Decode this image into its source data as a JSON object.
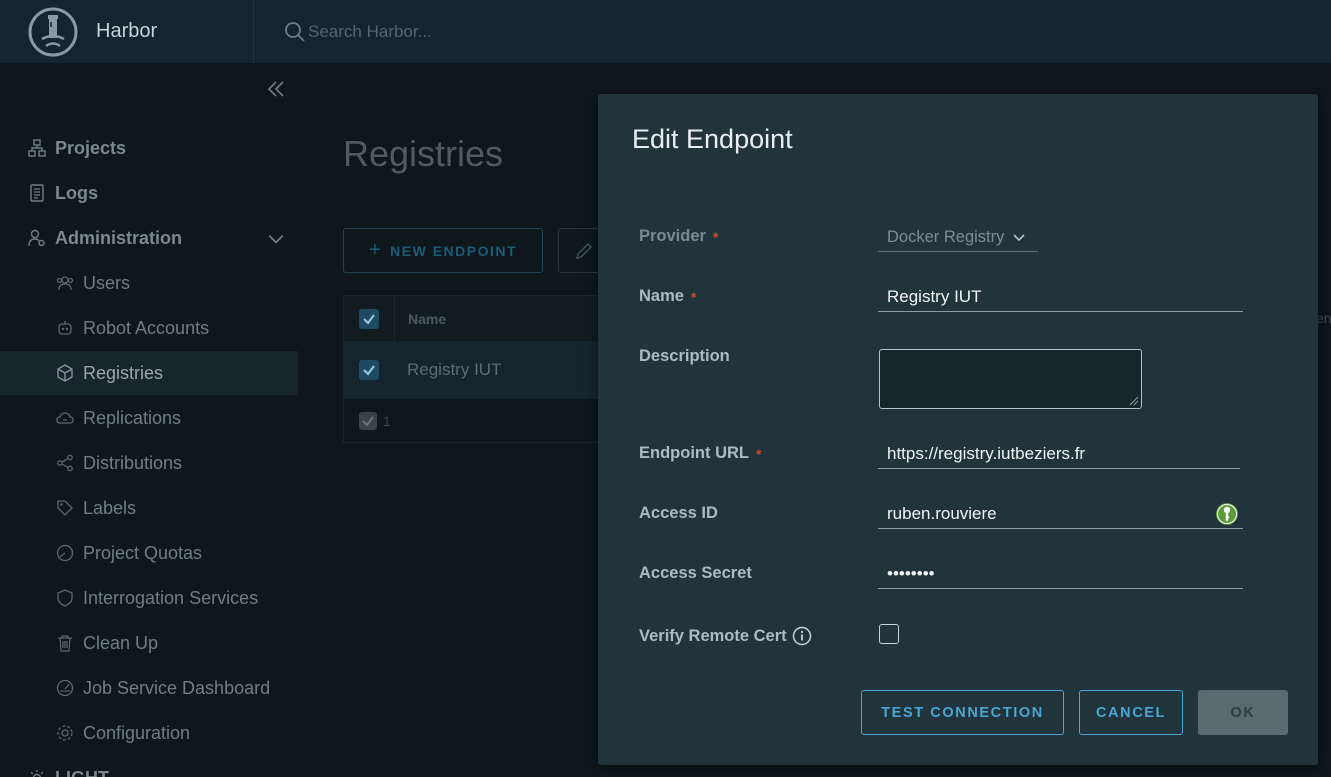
{
  "header": {
    "app_name": "Harbor",
    "search_placeholder": "Search Harbor..."
  },
  "sidebar": {
    "top_items": [
      {
        "label": "Projects",
        "icon": "projects-icon"
      },
      {
        "label": "Logs",
        "icon": "logs-icon"
      },
      {
        "label": "Administration",
        "icon": "administration-icon"
      }
    ],
    "admin_items": [
      {
        "label": "Users",
        "icon": "users-icon"
      },
      {
        "label": "Robot Accounts",
        "icon": "robot-icon"
      },
      {
        "label": "Registries",
        "icon": "registries-icon",
        "active": true
      },
      {
        "label": "Replications",
        "icon": "replications-icon"
      },
      {
        "label": "Distributions",
        "icon": "distributions-icon"
      },
      {
        "label": "Labels",
        "icon": "labels-icon"
      },
      {
        "label": "Project Quotas",
        "icon": "quotas-icon"
      },
      {
        "label": "Interrogation Services",
        "icon": "shield-icon"
      },
      {
        "label": "Clean Up",
        "icon": "trash-icon"
      },
      {
        "label": "Job Service Dashboard",
        "icon": "dashboard-icon"
      },
      {
        "label": "Configuration",
        "icon": "gear-icon"
      }
    ],
    "bottom_partial": "LIGHT"
  },
  "main": {
    "title": "Registries",
    "new_endpoint_label": "NEW ENDPOINT",
    "table": {
      "columns": [
        "Name"
      ],
      "rows": [
        {
          "name": "Registry IUT",
          "selected": true
        }
      ],
      "footer_count": "1",
      "edge_text": "en"
    }
  },
  "modal": {
    "title": "Edit Endpoint",
    "fields": {
      "provider": {
        "label": "Provider",
        "value": "Docker Registry",
        "required": true
      },
      "name": {
        "label": "Name",
        "value": "Registry IUT",
        "required": true
      },
      "description": {
        "label": "Description",
        "value": ""
      },
      "endpoint_url": {
        "label": "Endpoint URL",
        "value": "https://registry.iutbeziers.fr",
        "required": true
      },
      "access_id": {
        "label": "Access ID",
        "value": "ruben.rouviere"
      },
      "access_secret": {
        "label": "Access Secret",
        "value": "••••••••"
      },
      "verify_cert": {
        "label": "Verify Remote Cert",
        "checked": false
      }
    },
    "required_marker": "*",
    "buttons": {
      "test": "TEST CONNECTION",
      "cancel": "CANCEL",
      "ok": "OK"
    }
  },
  "colors": {
    "accent": "#49a7d6",
    "required": "#d04a2c",
    "modal_bg": "#21333b",
    "header_bg": "#122530"
  }
}
